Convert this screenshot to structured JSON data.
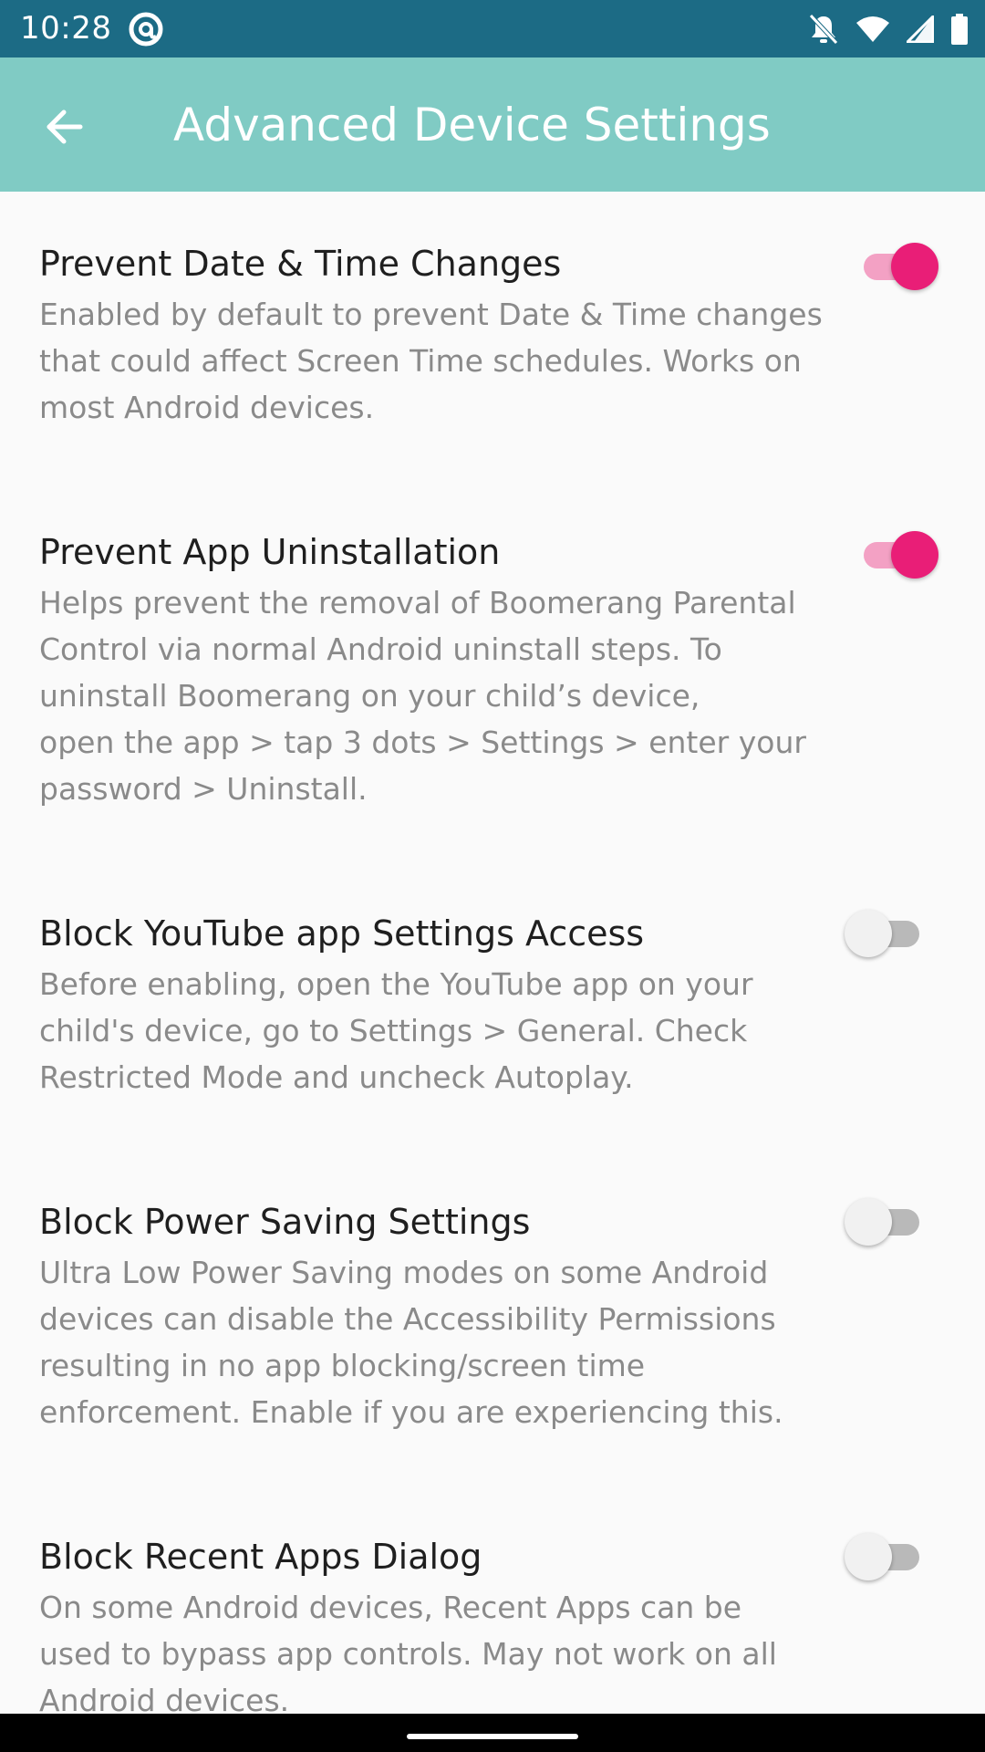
{
  "status_bar": {
    "time": "10:28",
    "app_icon": "at-sign-icon",
    "icons": [
      "notifications-off-icon",
      "wifi-icon",
      "cell-signal-icon",
      "battery-icon"
    ]
  },
  "app_bar": {
    "back_icon": "arrow-back-icon",
    "title": "Advanced Device Settings"
  },
  "settings": [
    {
      "title": "Prevent Date & Time Changes",
      "description": "Enabled by default to prevent Date & Time changes\nthat could affect Screen Time schedules. Works on\nmost Android devices.",
      "enabled": true
    },
    {
      "title": "Prevent App Uninstallation",
      "description": "Helps prevent the removal of Boomerang Parental\nControl via normal Android uninstall steps. To\nuninstall Boomerang on your child’s device,\nopen the app > tap 3 dots > Settings > enter your\npassword > Uninstall.",
      "enabled": true
    },
    {
      "title": "Block YouTube app Settings Access",
      "description": "Before enabling, open the YouTube app on your\nchild's device, go to Settings > General. Check\nRestricted Mode and uncheck Autoplay.",
      "enabled": false
    },
    {
      "title": "Block Power Saving Settings",
      "description": "Ultra Low Power Saving modes on some Android\ndevices can disable the Accessibility Permissions\nresulting in no app blocking/screen time\nenforcement. Enable if you are experiencing this.",
      "enabled": false
    },
    {
      "title": "Block Recent Apps Dialog",
      "description": "On some Android devices, Recent Apps can be\nused to bypass app controls. May not work on all\nAndroid devices.",
      "enabled": false
    }
  ],
  "colors": {
    "status_bar": "#1c6b85",
    "app_bar": "#80cbc4",
    "switch_on": "#e91e77",
    "switch_on_track": "#f3a1c4"
  }
}
